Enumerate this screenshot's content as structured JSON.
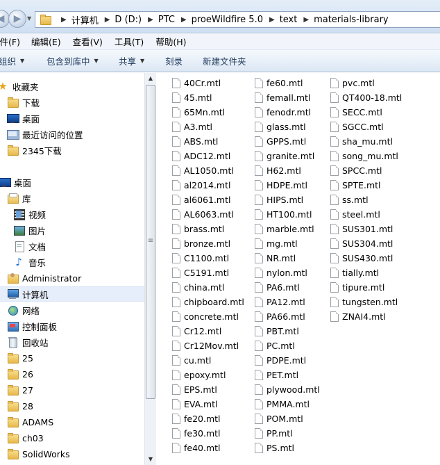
{
  "address": {
    "crumbs": [
      "计算机",
      "D (D:)",
      "PTC",
      "proeWildfire 5.0",
      "text",
      "materials-library"
    ]
  },
  "menu": [
    "文件(F)",
    "编辑(E)",
    "查看(V)",
    "工具(T)",
    "帮助(H)"
  ],
  "commands": [
    {
      "label": "组织",
      "dropdown": true
    },
    {
      "label": "包含到库中",
      "dropdown": true
    },
    {
      "label": "共享",
      "dropdown": true
    },
    {
      "label": "刻录",
      "dropdown": false
    },
    {
      "label": "新建文件夹",
      "dropdown": false
    }
  ],
  "nav": {
    "favorites": {
      "label": "收藏夹",
      "icon": "star-icon"
    },
    "favorite_items": [
      {
        "label": "下载",
        "icon": "folder-icon"
      },
      {
        "label": "桌面",
        "icon": "desktop-icon"
      },
      {
        "label": "最近访问的位置",
        "icon": "recent-places-icon"
      },
      {
        "label": "2345下载",
        "icon": "folder-icon"
      }
    ],
    "desktop": {
      "label": "桌面",
      "icon": "desktop-icon"
    },
    "library": {
      "label": "库",
      "icon": "library-icon"
    },
    "library_items": [
      {
        "label": "视频",
        "icon": "video-icon"
      },
      {
        "label": "图片",
        "icon": "picture-icon"
      },
      {
        "label": "文档",
        "icon": "document-icon"
      },
      {
        "label": "音乐",
        "icon": "music-icon"
      }
    ],
    "top_items": [
      {
        "label": "Administrator",
        "icon": "user-folder-icon"
      },
      {
        "label": "计算机",
        "icon": "computer-icon",
        "selected": true
      },
      {
        "label": "网络",
        "icon": "network-icon"
      },
      {
        "label": "控制面板",
        "icon": "control-panel-icon"
      },
      {
        "label": "回收站",
        "icon": "recycle-bin-icon"
      },
      {
        "label": "25",
        "icon": "folder-icon"
      },
      {
        "label": "26",
        "icon": "folder-icon"
      },
      {
        "label": "27",
        "icon": "folder-icon"
      },
      {
        "label": "28",
        "icon": "folder-icon"
      },
      {
        "label": "ADAMS",
        "icon": "folder-icon"
      },
      {
        "label": "ch03",
        "icon": "folder-icon"
      },
      {
        "label": "SolidWorks",
        "icon": "folder-icon"
      }
    ]
  },
  "files": {
    "col1": [
      "40Cr.mtl",
      "45.mtl",
      "65Mn.mtl",
      "A3.mtl",
      "ABS.mtl",
      "ADC12.mtl",
      "AL1050.mtl",
      "al2014.mtl",
      "al6061.mtl",
      "AL6063.mtl",
      "brass.mtl",
      "bronze.mtl",
      "C1100.mtl",
      "C5191.mtl",
      "china.mtl",
      "chipboard.mtl",
      "concrete.mtl",
      "Cr12.mtl",
      "Cr12Mov.mtl",
      "cu.mtl",
      "epoxy.mtl",
      "EPS.mtl",
      "EVA.mtl",
      "fe20.mtl",
      "fe30.mtl",
      "fe40.mtl"
    ],
    "col2": [
      "fe60.mtl",
      "femall.mtl",
      "fenodr.mtl",
      "glass.mtl",
      "GPPS.mtl",
      "granite.mtl",
      "H62.mtl",
      "HDPE.mtl",
      "HIPS.mtl",
      "HT100.mtl",
      "marble.mtl",
      "mg.mtl",
      "NR.mtl",
      "nylon.mtl",
      "PA6.mtl",
      "PA12.mtl",
      "PA66.mtl",
      "PBT.mtl",
      "PC.mtl",
      "PDPE.mtl",
      "PET.mtl",
      "plywood.mtl",
      "PMMA.mtl",
      "POM.mtl",
      "PP.mtl",
      "PS.mtl"
    ],
    "col3": [
      "pvc.mtl",
      "QT400-18.mtl",
      "SECC.mtl",
      "SGCC.mtl",
      "sha_mu.mtl",
      "song_mu.mtl",
      "SPCC.mtl",
      "SPTE.mtl",
      "ss.mtl",
      "steel.mtl",
      "SUS301.mtl",
      "SUS304.mtl",
      "SUS430.mtl",
      "tially.mtl",
      "tipure.mtl",
      "tungsten.mtl",
      "ZNAI4.mtl"
    ]
  }
}
